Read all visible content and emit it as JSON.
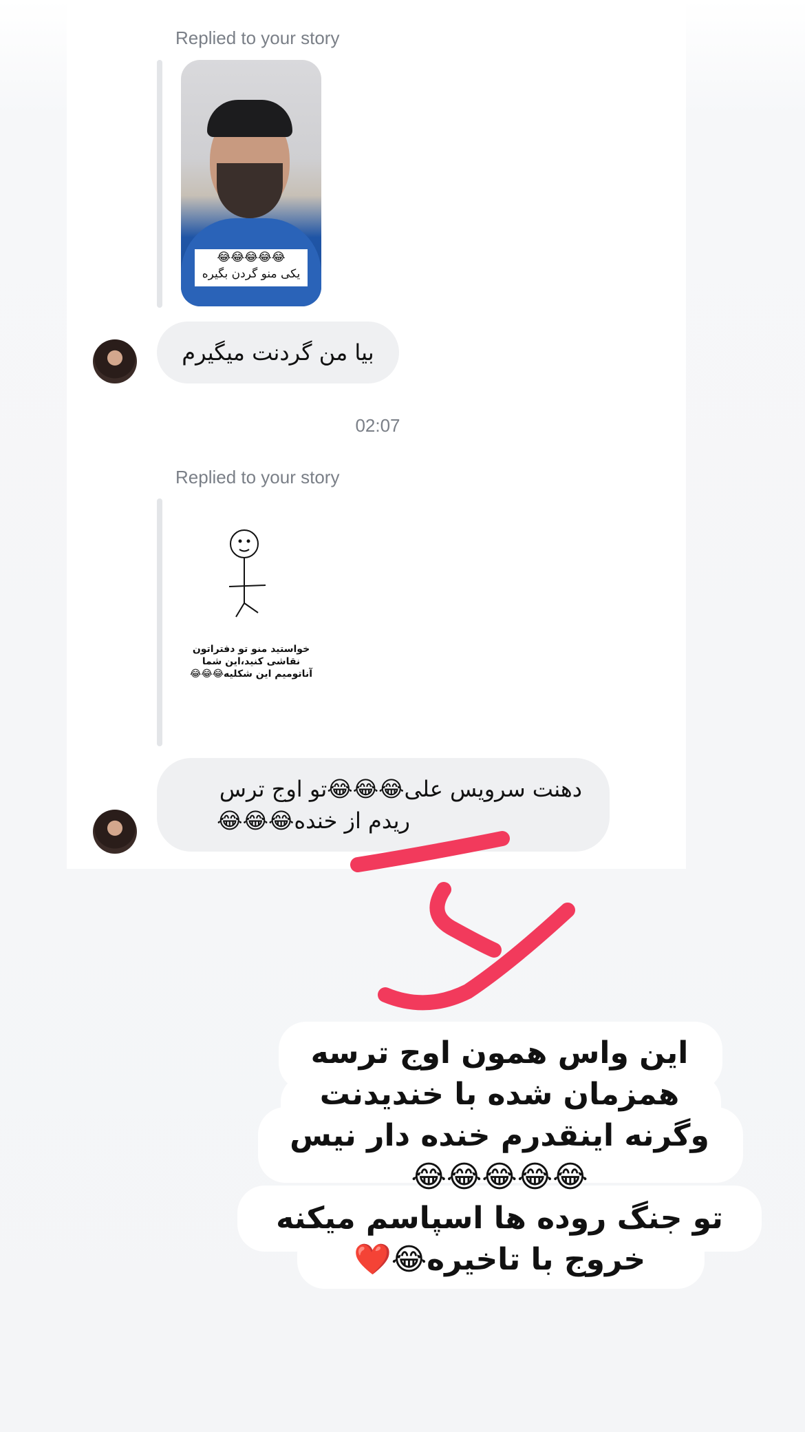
{
  "conversation": {
    "story_reply_1": {
      "label": "Replied to your story",
      "story_caption_emojis": "😂😂😂😂😂",
      "story_caption_text": "یکی منو گردن بگیره"
    },
    "message_1": "بیا من گردنت میگیرم",
    "timestamp": "02:07",
    "story_reply_2": {
      "label": "Replied to your story",
      "story_caption_line1": "خواستید منو تو دفتراتون",
      "story_caption_line2": "نقاشی کنید،این شما",
      "story_caption_line3": "آناتومیم این شکلیه😂😂😂"
    },
    "message_2_line1": "دهنت سرویس علی😂😂😂تو اوج ترس",
    "message_2_line2": "ریدم از خنده😂😂😂"
  },
  "overlay_text": {
    "line1": "این واس همون اوج ترسه",
    "line2": "همزمان شده با خندیدنت",
    "line3": "وگرنه اینقدرم خنده دار نیس",
    "line4": "😂😂😂😂😂",
    "line5": "تو جنگ روده ها اسپاسم میکنه",
    "line6": "خروج با تاخیره😂❤️"
  },
  "colors": {
    "annotation_stroke": "#f23a5c",
    "bubble_bg": "#eff0f2",
    "meta_text": "#7a7f87"
  }
}
